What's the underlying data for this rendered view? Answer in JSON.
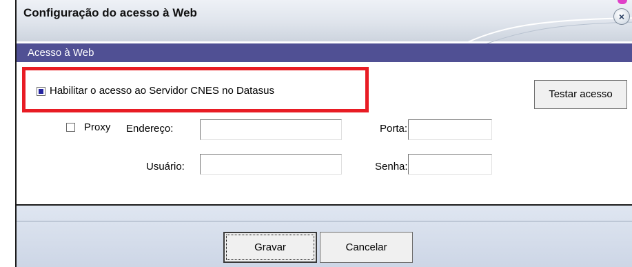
{
  "window": {
    "title": "Configuração do acesso à Web",
    "close_glyph": "×"
  },
  "section": {
    "label": "Acesso à Web"
  },
  "web_access": {
    "enable_label": "Habilitar o acesso ao Servidor CNES no Datasus",
    "enable_checked": true,
    "test_button": "Testar acesso",
    "proxy_label": "Proxy",
    "proxy_checked": false,
    "address_label": "Endereço:",
    "address_value": "",
    "port_label": "Porta:",
    "port_value": "",
    "user_label": "Usuário:",
    "user_value": "",
    "password_label": "Senha:",
    "password_value": ""
  },
  "footer": {
    "save_button": "Gravar",
    "cancel_button": "Cancelar"
  },
  "colors": {
    "header_bg": "#505094",
    "highlight": "#e81c24",
    "check_fill": "#2424a0"
  },
  "icons": {
    "close": "close-icon"
  }
}
